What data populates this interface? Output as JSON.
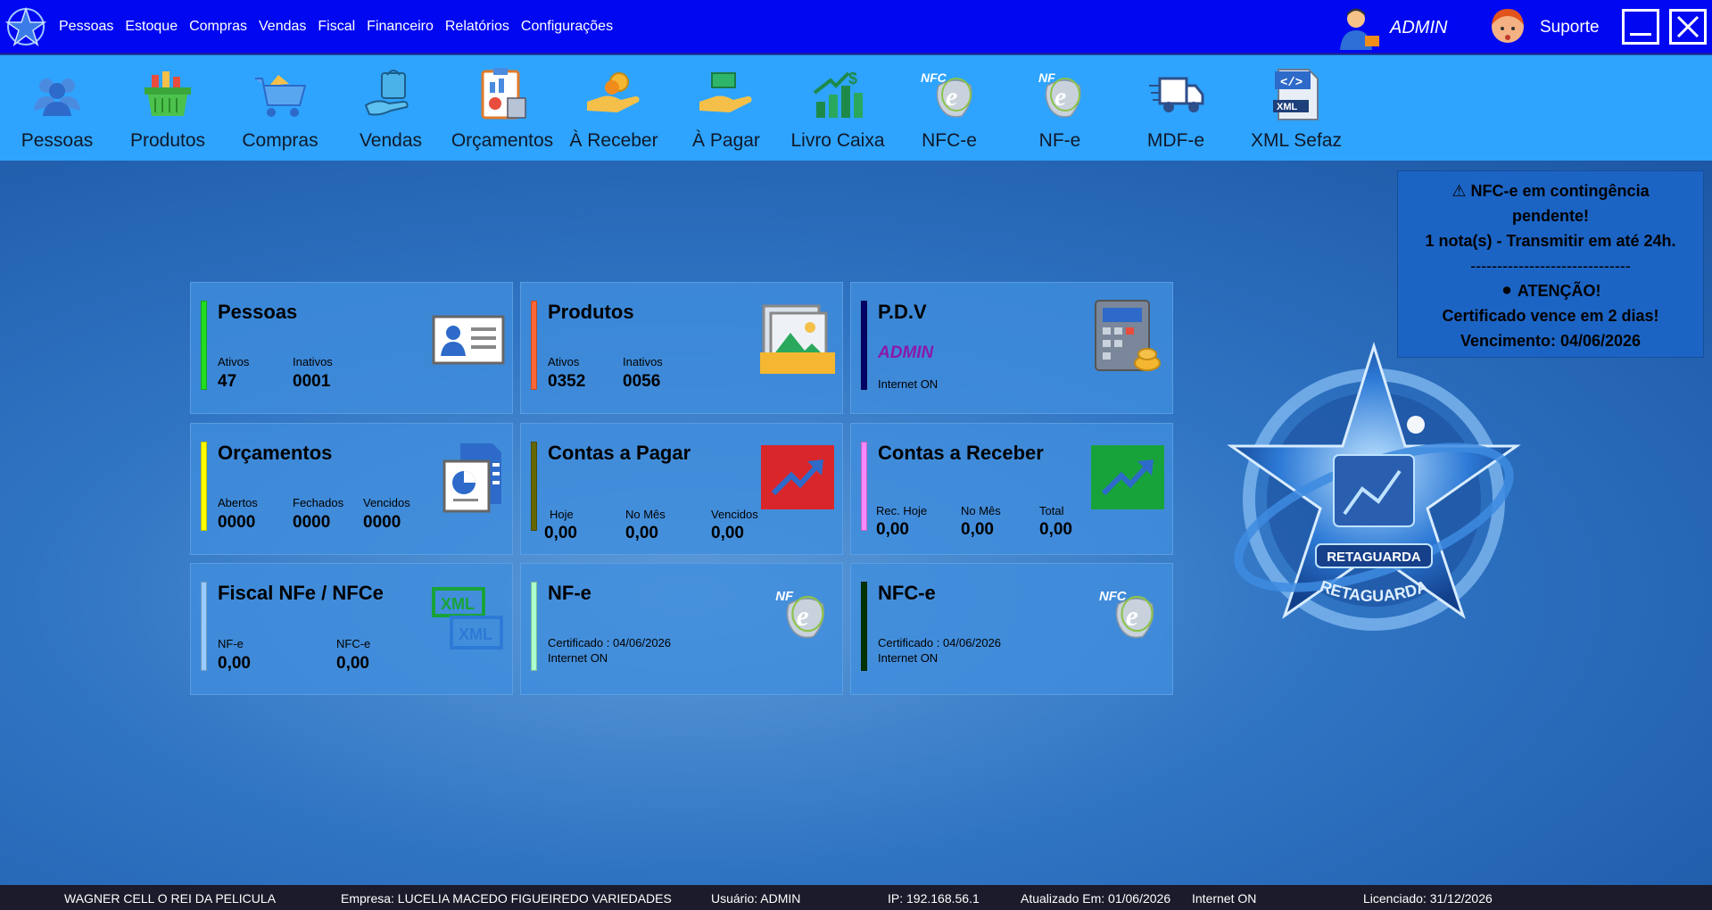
{
  "menubar": {
    "items": [
      "Pessoas",
      "Estoque",
      "Compras",
      "Vendas",
      "Fiscal",
      "Financeiro",
      "Relatórios",
      "Configurações"
    ],
    "user_name": "ADMIN",
    "support_label": "Suporte"
  },
  "toolbar": {
    "buttons": [
      {
        "label": "Pessoas",
        "icon": "people-icon"
      },
      {
        "label": "Produtos",
        "icon": "basket-icon"
      },
      {
        "label": "Compras",
        "icon": "cart-icon"
      },
      {
        "label": "Vendas",
        "icon": "hand-bag-icon"
      },
      {
        "label": "Orçamentos",
        "icon": "clipboard-chart-icon"
      },
      {
        "label": "À Receber",
        "icon": "hand-coin-icon"
      },
      {
        "label": "À Pagar",
        "icon": "hand-money-icon"
      },
      {
        "label": "Livro Caixa",
        "icon": "growth-chart-icon"
      },
      {
        "label": "NFC-e",
        "icon": "nfce-logo-icon"
      },
      {
        "label": "NF-e",
        "icon": "nfe-logo-icon"
      },
      {
        "label": "MDF-e",
        "icon": "truck-icon"
      },
      {
        "label": "XML Sefaz",
        "icon": "xml-file-icon"
      }
    ]
  },
  "cards": {
    "pessoas": {
      "title": "Pessoas",
      "ativos_label": "Ativos",
      "ativos": "47",
      "inativos_label": "Inativos",
      "inativos": "0001",
      "color": "#22dd22"
    },
    "produtos": {
      "title": "Produtos",
      "ativos_label": "Ativos",
      "ativos": "0352",
      "inativos_label": "Inativos",
      "inativos": "0056",
      "color": "#ff6633"
    },
    "pdv": {
      "title": "P.D.V",
      "user": "ADMIN",
      "status": "Internet ON",
      "color": "#000066"
    },
    "orcamentos": {
      "title": "Orçamentos",
      "abertos_label": "Abertos",
      "abertos": "0000",
      "fechados_label": "Fechados",
      "fechados": "0000",
      "vencidos_label": "Vencidos",
      "vencidos": "0000",
      "color": "#ffff00"
    },
    "pagar": {
      "title": "Contas a Pagar",
      "hoje_label": "Hoje",
      "hoje": "0,00",
      "mes_label": "No Mês",
      "mes": "0,00",
      "vencidos_label": "Vencidos",
      "vencidos": "0,00",
      "color": "#666600"
    },
    "receber": {
      "title": "Contas a Receber",
      "hoje_label": "Rec. Hoje",
      "hoje": "0,00",
      "mes_label": "No Mês",
      "mes": "0,00",
      "total_label": "Total",
      "total": "0,00",
      "color": "#ff88ff"
    },
    "fiscal": {
      "title": "Fiscal NFe / NFCe",
      "nfe_label": "NF-e",
      "nfe": "0,00",
      "nfce_label": "NFC-e",
      "nfce": "0,00",
      "color": "#99ccff"
    },
    "nfe": {
      "title": "NF-e",
      "certificado": "Certificado : 04/06/2026",
      "status": "Internet ON",
      "color": "#aaffcc"
    },
    "nfce": {
      "title": "NFC-e",
      "certificado": "Certificado : 04/06/2026",
      "status": "Internet ON",
      "color": "#003300"
    }
  },
  "alert": {
    "line1": "⚠ NFC-e em contingência",
    "line2": "pendente!",
    "line3": "1 nota(s) - Transmitir em até 24h.",
    "line4": "------------------------------",
    "line5": "⚫ ATENÇÃO!",
    "line6": "Certificado vence em 2 dias!",
    "line7": "Vencimento: 04/06/2026"
  },
  "emblem": {
    "label_top": "RETAGUARDA",
    "label_bottom": "RETAGUARDA"
  },
  "statusbar": {
    "company_short": "WAGNER CELL O REI DA PELICULA",
    "empresa": "Empresa: LUCELIA MACEDO FIGUEIREDO VARIEDADES",
    "usuario": "Usuário: ADMIN",
    "ip": "IP: 192.168.56.1",
    "atualizado": "Atualizado Em: 01/06/2026",
    "internet": "Internet ON",
    "licenciado": "Licenciado: 31/12/2026"
  },
  "colors": {
    "menubar": "#0008f2",
    "toolbar": "#2ea4ff",
    "alert": "#1c64c4",
    "pdv_user": "#8b1aa8"
  }
}
